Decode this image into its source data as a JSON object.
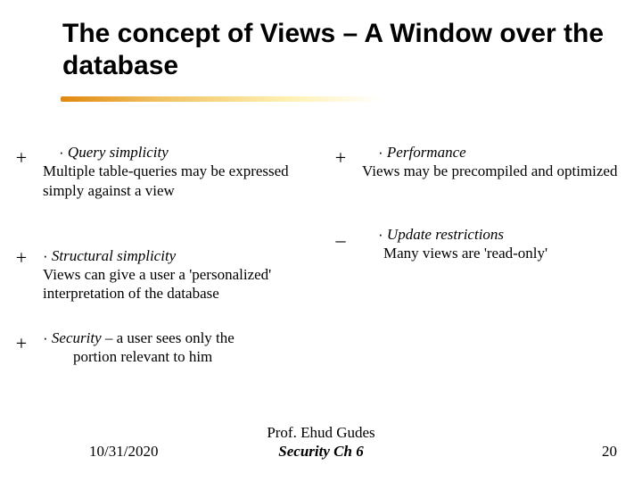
{
  "title": "The concept of Views – A Window over the database",
  "left": {
    "item1": {
      "sign": "+",
      "bullet": "·",
      "heading": "Query simplicity",
      "body": "Multiple table-queries may be expressed simply against a view"
    },
    "item2": {
      "sign": "+",
      "bullet": "·",
      "heading": "Structural simplicity",
      "body": "Views can give a user a 'personalized' interpretation of the database"
    },
    "item3": {
      "sign": "+",
      "bullet": "·",
      "heading": "Security",
      "body_inline": " – a user sees only the",
      "body_cont": "portion relevant to him"
    }
  },
  "right": {
    "item1": {
      "sign": "+",
      "bullet": "·",
      "heading": "Performance",
      "body": "Views may be precompiled and optimized"
    },
    "item2": {
      "sign": "–",
      "bullet": "·",
      "heading": "Update restrictions",
      "body": "Many views are 'read-only'"
    }
  },
  "footer": {
    "date": "10/31/2020",
    "author": "Prof. Ehud Gudes",
    "course": "Security  Ch 6",
    "page": "20"
  }
}
